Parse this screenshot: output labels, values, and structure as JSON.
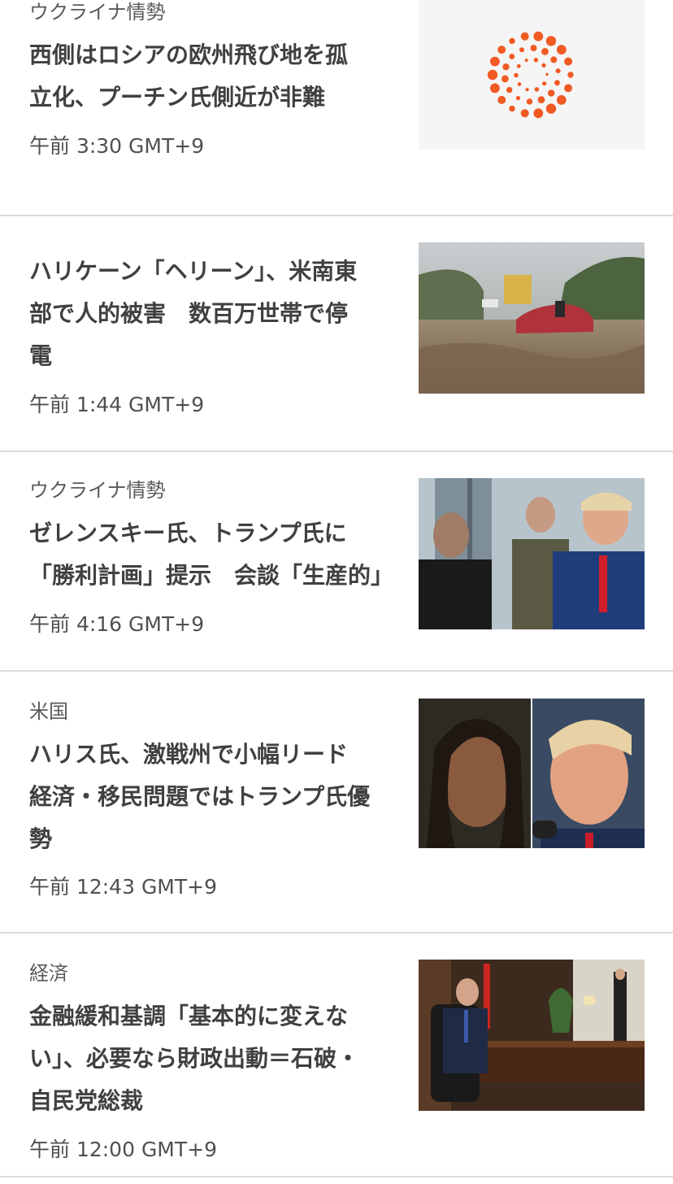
{
  "articles": [
    {
      "category": "ウクライナ情勢",
      "headline_lines": [
        "西側はロシアの欧州飛び地を孤",
        "立化、プーチン氏側近が非難"
      ],
      "time": "午前 3:30 GMT+9",
      "image": "reuters-logo-placeholder"
    },
    {
      "category": "",
      "headline_lines": [
        "ハリケーン「ヘリーン」、米南東",
        "部で人的被害　数百万世帯で停",
        "電"
      ],
      "time": "午前 1:44 GMT+9",
      "image": "flooded-road-photo"
    },
    {
      "category": "ウクライナ情勢",
      "headline_lines": [
        "ゼレンスキー氏、トランプ氏に",
        "「勝利計画」提示　会談「生産的」"
      ],
      "time": "午前 4:16 GMT+9",
      "image": "zelensky-trump-photo"
    },
    {
      "category": "米国",
      "headline_lines": [
        "ハリス氏、激戦州で小幅リード",
        "経済・移民問題ではトランプ氏優",
        "勢"
      ],
      "time": "午前 12:43 GMT+9",
      "image": "harris-trump-photo"
    },
    {
      "category": "経済",
      "headline_lines": [
        "金融緩和基調「基本的に変えな",
        "い」、必要なら財政出動＝石破・",
        "自民党総裁"
      ],
      "time": "午前 12:00 GMT+9",
      "image": "ishiba-office-photo"
    }
  ],
  "colors": {
    "accent": "#f05a23",
    "divider": "#dcdcdc",
    "text": "#404040"
  }
}
